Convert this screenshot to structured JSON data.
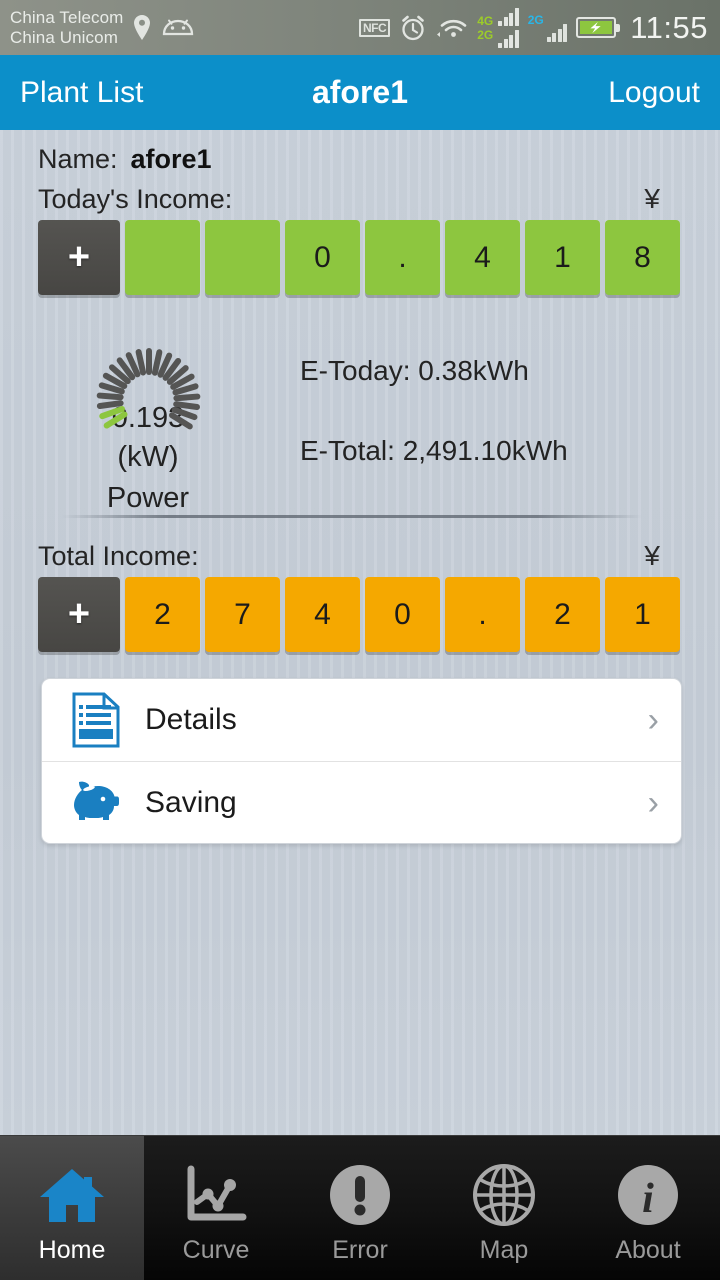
{
  "status_bar": {
    "carrier_line1": "China Telecom",
    "carrier_line2": "China Unicom",
    "location_icon": "location-pin-icon",
    "android_icon": "android-robot-icon",
    "nfc_label": "NFC",
    "alarm_icon": "alarm-clock-icon",
    "wifi_icon": "wifi-icon",
    "sim1_label_top": "4G",
    "sim1_label_bottom": "2G",
    "sim2_label": "2G",
    "battery_icon": "battery-charging-icon",
    "time": "11:55"
  },
  "app_bar": {
    "back_label": "Plant List",
    "title": "afore1",
    "logout_label": "Logout"
  },
  "plant": {
    "name_label": "Name:",
    "name_value": "afore1",
    "today_income_label": "Today's Income:",
    "today_income_currency": "¥",
    "today_income_plus": "+",
    "today_income_digits": [
      "",
      "",
      "0",
      ".",
      "4",
      "1",
      "8"
    ],
    "today_income_value": "0.418",
    "total_income_label": "Total Income:",
    "total_income_currency": "¥",
    "total_income_plus": "+",
    "total_income_digits": [
      "2",
      "7",
      "4",
      "0",
      ".",
      "2",
      "1"
    ],
    "total_income_value": "2740.21"
  },
  "gauge": {
    "value": "0.193",
    "unit": "(kW)",
    "caption": "Power",
    "tick_count": 21,
    "active_ticks": 2,
    "active_color": "#8dc63f",
    "inactive_color": "#555554"
  },
  "stats": {
    "e_today": "E-Today: 0.38kWh",
    "e_total": "E-Total: 2,491.10kWh"
  },
  "menu": {
    "items": [
      {
        "label": "Details",
        "icon": "document-icon",
        "chevron": "›"
      },
      {
        "label": "Saving",
        "icon": "piggy-bank-icon",
        "chevron": "›"
      }
    ]
  },
  "tabbar": {
    "items": [
      {
        "label": "Home",
        "icon": "home-icon",
        "active": true
      },
      {
        "label": "Curve",
        "icon": "line-chart-icon",
        "active": false
      },
      {
        "label": "Error",
        "icon": "exclamation-icon",
        "active": false
      },
      {
        "label": "Map",
        "icon": "globe-icon",
        "active": false
      },
      {
        "label": "About",
        "icon": "info-icon",
        "active": false
      }
    ]
  },
  "colors": {
    "accent_blue": "#0c8fc9",
    "green_tile": "#8dc63f",
    "orange_tile": "#f5a800",
    "dark_tile": "#4d4c49",
    "background": "#c5cdd8"
  }
}
